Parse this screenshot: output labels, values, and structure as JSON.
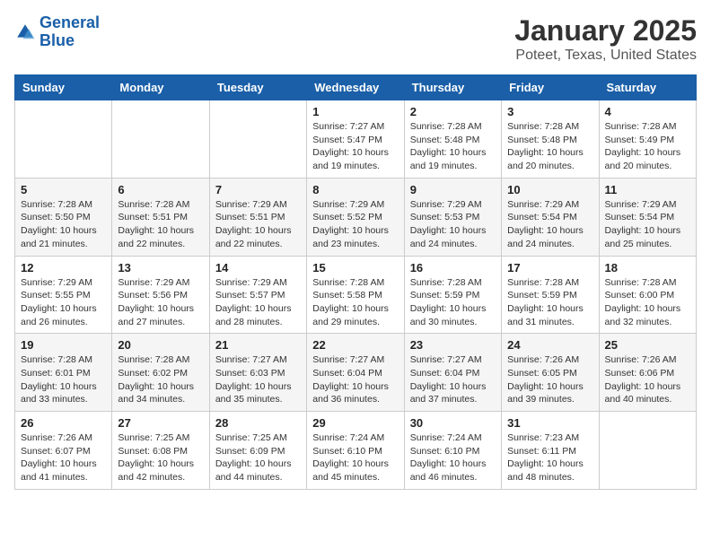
{
  "logo": {
    "text_general": "General",
    "text_blue": "Blue"
  },
  "title": "January 2025",
  "subtitle": "Poteet, Texas, United States",
  "days_of_week": [
    "Sunday",
    "Monday",
    "Tuesday",
    "Wednesday",
    "Thursday",
    "Friday",
    "Saturday"
  ],
  "weeks": [
    [
      {
        "day": "",
        "info": ""
      },
      {
        "day": "",
        "info": ""
      },
      {
        "day": "",
        "info": ""
      },
      {
        "day": "1",
        "info": "Sunrise: 7:27 AM\nSunset: 5:47 PM\nDaylight: 10 hours\nand 19 minutes."
      },
      {
        "day": "2",
        "info": "Sunrise: 7:28 AM\nSunset: 5:48 PM\nDaylight: 10 hours\nand 19 minutes."
      },
      {
        "day": "3",
        "info": "Sunrise: 7:28 AM\nSunset: 5:48 PM\nDaylight: 10 hours\nand 20 minutes."
      },
      {
        "day": "4",
        "info": "Sunrise: 7:28 AM\nSunset: 5:49 PM\nDaylight: 10 hours\nand 20 minutes."
      }
    ],
    [
      {
        "day": "5",
        "info": "Sunrise: 7:28 AM\nSunset: 5:50 PM\nDaylight: 10 hours\nand 21 minutes."
      },
      {
        "day": "6",
        "info": "Sunrise: 7:28 AM\nSunset: 5:51 PM\nDaylight: 10 hours\nand 22 minutes."
      },
      {
        "day": "7",
        "info": "Sunrise: 7:29 AM\nSunset: 5:51 PM\nDaylight: 10 hours\nand 22 minutes."
      },
      {
        "day": "8",
        "info": "Sunrise: 7:29 AM\nSunset: 5:52 PM\nDaylight: 10 hours\nand 23 minutes."
      },
      {
        "day": "9",
        "info": "Sunrise: 7:29 AM\nSunset: 5:53 PM\nDaylight: 10 hours\nand 24 minutes."
      },
      {
        "day": "10",
        "info": "Sunrise: 7:29 AM\nSunset: 5:54 PM\nDaylight: 10 hours\nand 24 minutes."
      },
      {
        "day": "11",
        "info": "Sunrise: 7:29 AM\nSunset: 5:54 PM\nDaylight: 10 hours\nand 25 minutes."
      }
    ],
    [
      {
        "day": "12",
        "info": "Sunrise: 7:29 AM\nSunset: 5:55 PM\nDaylight: 10 hours\nand 26 minutes."
      },
      {
        "day": "13",
        "info": "Sunrise: 7:29 AM\nSunset: 5:56 PM\nDaylight: 10 hours\nand 27 minutes."
      },
      {
        "day": "14",
        "info": "Sunrise: 7:29 AM\nSunset: 5:57 PM\nDaylight: 10 hours\nand 28 minutes."
      },
      {
        "day": "15",
        "info": "Sunrise: 7:28 AM\nSunset: 5:58 PM\nDaylight: 10 hours\nand 29 minutes."
      },
      {
        "day": "16",
        "info": "Sunrise: 7:28 AM\nSunset: 5:59 PM\nDaylight: 10 hours\nand 30 minutes."
      },
      {
        "day": "17",
        "info": "Sunrise: 7:28 AM\nSunset: 5:59 PM\nDaylight: 10 hours\nand 31 minutes."
      },
      {
        "day": "18",
        "info": "Sunrise: 7:28 AM\nSunset: 6:00 PM\nDaylight: 10 hours\nand 32 minutes."
      }
    ],
    [
      {
        "day": "19",
        "info": "Sunrise: 7:28 AM\nSunset: 6:01 PM\nDaylight: 10 hours\nand 33 minutes."
      },
      {
        "day": "20",
        "info": "Sunrise: 7:28 AM\nSunset: 6:02 PM\nDaylight: 10 hours\nand 34 minutes."
      },
      {
        "day": "21",
        "info": "Sunrise: 7:27 AM\nSunset: 6:03 PM\nDaylight: 10 hours\nand 35 minutes."
      },
      {
        "day": "22",
        "info": "Sunrise: 7:27 AM\nSunset: 6:04 PM\nDaylight: 10 hours\nand 36 minutes."
      },
      {
        "day": "23",
        "info": "Sunrise: 7:27 AM\nSunset: 6:04 PM\nDaylight: 10 hours\nand 37 minutes."
      },
      {
        "day": "24",
        "info": "Sunrise: 7:26 AM\nSunset: 6:05 PM\nDaylight: 10 hours\nand 39 minutes."
      },
      {
        "day": "25",
        "info": "Sunrise: 7:26 AM\nSunset: 6:06 PM\nDaylight: 10 hours\nand 40 minutes."
      }
    ],
    [
      {
        "day": "26",
        "info": "Sunrise: 7:26 AM\nSunset: 6:07 PM\nDaylight: 10 hours\nand 41 minutes."
      },
      {
        "day": "27",
        "info": "Sunrise: 7:25 AM\nSunset: 6:08 PM\nDaylight: 10 hours\nand 42 minutes."
      },
      {
        "day": "28",
        "info": "Sunrise: 7:25 AM\nSunset: 6:09 PM\nDaylight: 10 hours\nand 44 minutes."
      },
      {
        "day": "29",
        "info": "Sunrise: 7:24 AM\nSunset: 6:10 PM\nDaylight: 10 hours\nand 45 minutes."
      },
      {
        "day": "30",
        "info": "Sunrise: 7:24 AM\nSunset: 6:10 PM\nDaylight: 10 hours\nand 46 minutes."
      },
      {
        "day": "31",
        "info": "Sunrise: 7:23 AM\nSunset: 6:11 PM\nDaylight: 10 hours\nand 48 minutes."
      },
      {
        "day": "",
        "info": ""
      }
    ]
  ]
}
